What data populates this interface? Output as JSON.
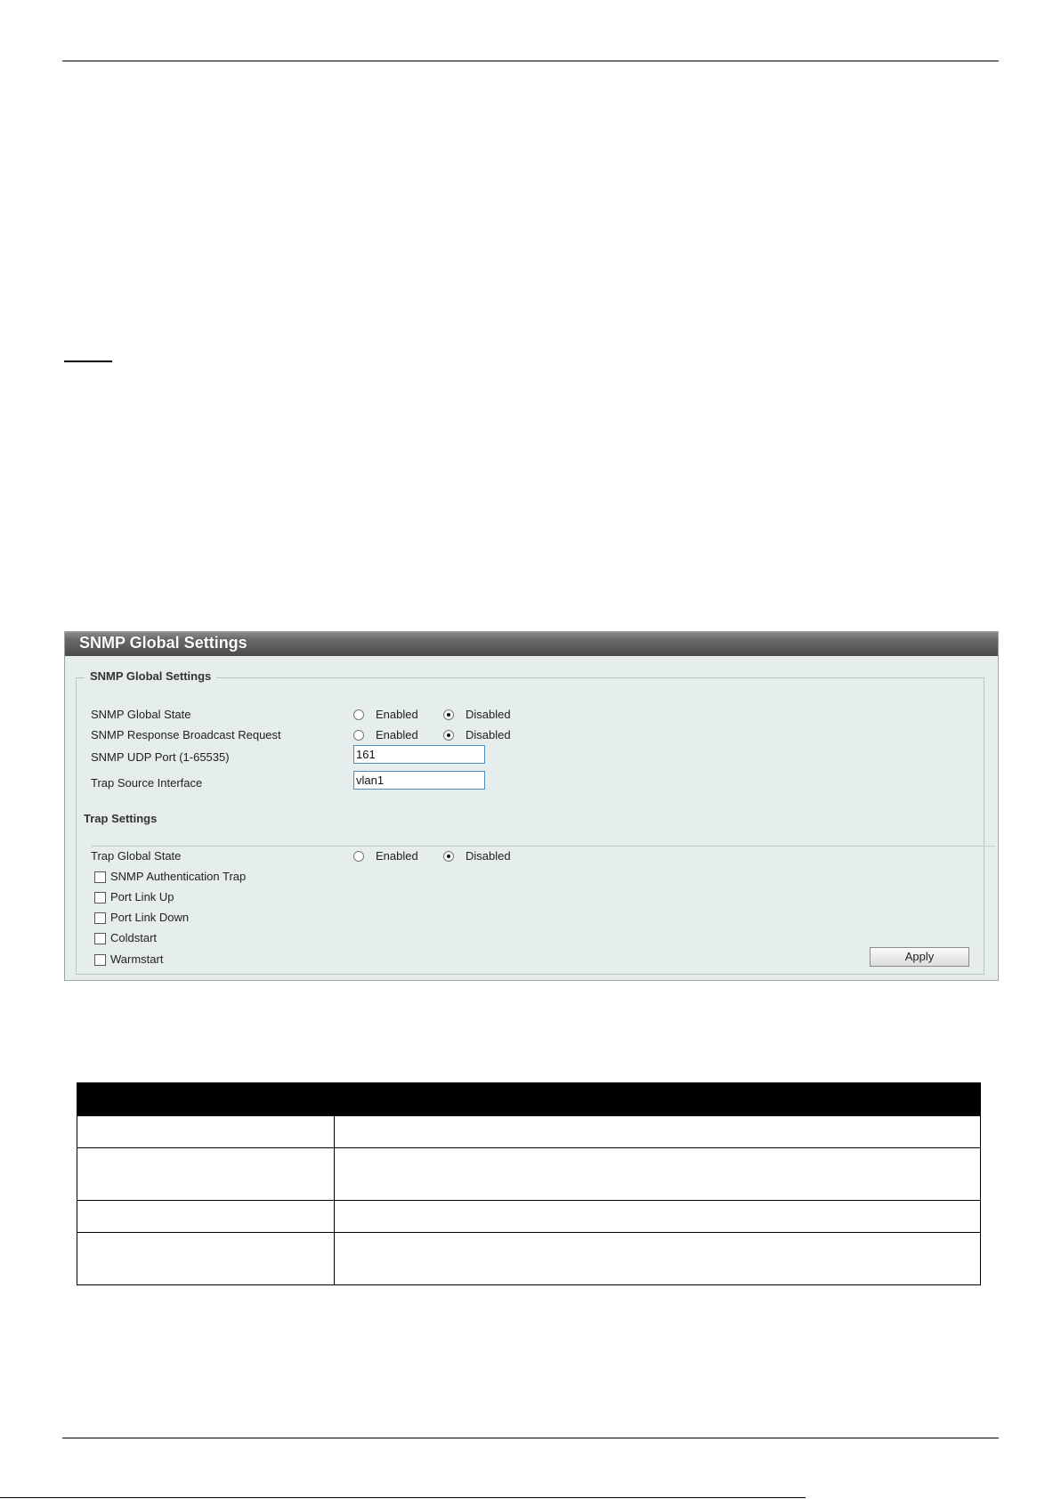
{
  "panel": {
    "title": "SNMP Global Settings",
    "section_global": {
      "legend": "SNMP Global Settings",
      "rows": [
        {
          "label": "SNMP Global State",
          "enabled_label": "Enabled",
          "disabled_label": "Disabled",
          "selected": "Disabled"
        },
        {
          "label": "SNMP Response Broadcast Request",
          "enabled_label": "Enabled",
          "disabled_label": "Disabled",
          "selected": "Disabled"
        }
      ],
      "udp_port": {
        "label": "SNMP UDP Port (1-65535)",
        "value": "161"
      },
      "trap_source": {
        "label": "Trap Source Interface",
        "value": "vlan1"
      }
    },
    "section_trap": {
      "title": "Trap Settings",
      "global_state": {
        "label": "Trap Global State",
        "enabled_label": "Enabled",
        "disabled_label": "Disabled",
        "selected": "Disabled"
      },
      "checkboxes": [
        {
          "label": "SNMP Authentication Trap",
          "checked": false
        },
        {
          "label": "Port Link Up",
          "checked": false
        },
        {
          "label": "Port Link Down",
          "checked": false
        },
        {
          "label": "Coldstart",
          "checked": false
        },
        {
          "label": "Warmstart",
          "checked": false
        }
      ]
    },
    "apply_label": "Apply"
  }
}
